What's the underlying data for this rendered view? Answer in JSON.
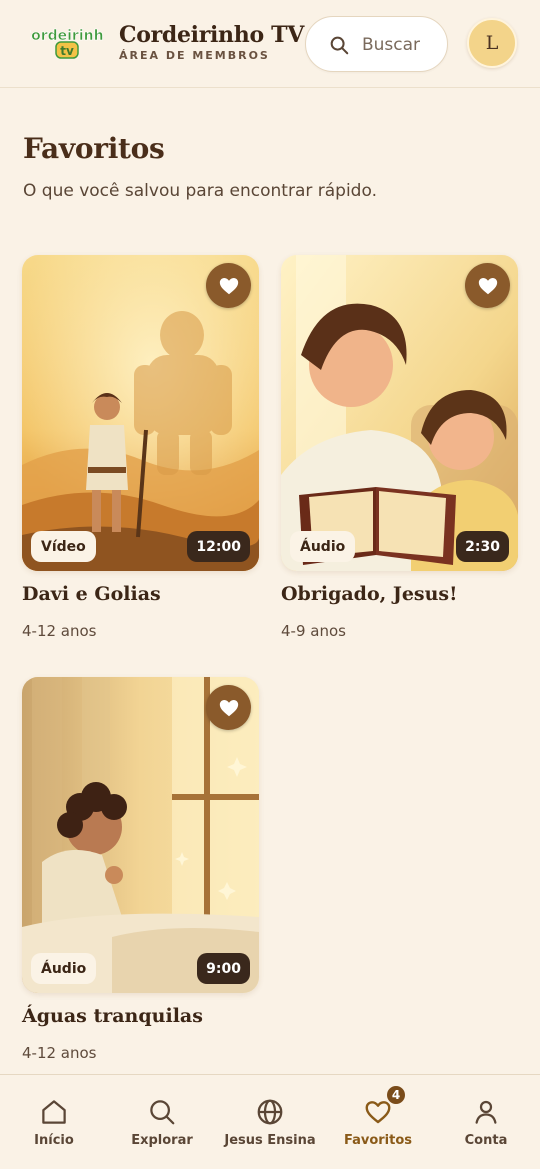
{
  "header": {
    "logo_text_top": "Cordeirinho",
    "logo_text_bottom": "tv",
    "brand_title": "Cordeirinho TV",
    "brand_subtitle": "ÁREA DE MEMBROS",
    "search_placeholder": "Buscar",
    "search_icon": "search-icon",
    "avatar_initial": "L"
  },
  "page": {
    "title": "Favoritos",
    "subtitle": "O que você salvou para encontrar rápido."
  },
  "favorites": [
    {
      "title": "Davi e Golias",
      "age": "4-12 anos",
      "type": "Vídeo",
      "duration": "12:00",
      "favorited": true,
      "icon": "heart-icon"
    },
    {
      "title": "Obrigado, Jesus!",
      "age": "4-9 anos",
      "type": "Áudio",
      "duration": "2:30",
      "favorited": true,
      "icon": "heart-icon"
    },
    {
      "title": "Águas tranquilas",
      "age": "4-12 anos",
      "type": "Áudio",
      "duration": "9:00",
      "favorited": true,
      "icon": "heart-icon"
    }
  ],
  "bottom_nav": {
    "items": [
      {
        "label": "Início",
        "icon": "home-icon"
      },
      {
        "label": "Explorar",
        "icon": "search-icon"
      },
      {
        "label": "Jesus Ensina",
        "icon": "globe-icon"
      },
      {
        "label": "Favoritos",
        "icon": "heart-icon",
        "active": true,
        "badge": "4"
      },
      {
        "label": "Conta",
        "icon": "user-icon"
      }
    ]
  },
  "colors": {
    "background": "#faf2e6",
    "accent": "#8a5a2b",
    "active_nav": "#8a5a18",
    "text_dark": "#3c2616"
  }
}
